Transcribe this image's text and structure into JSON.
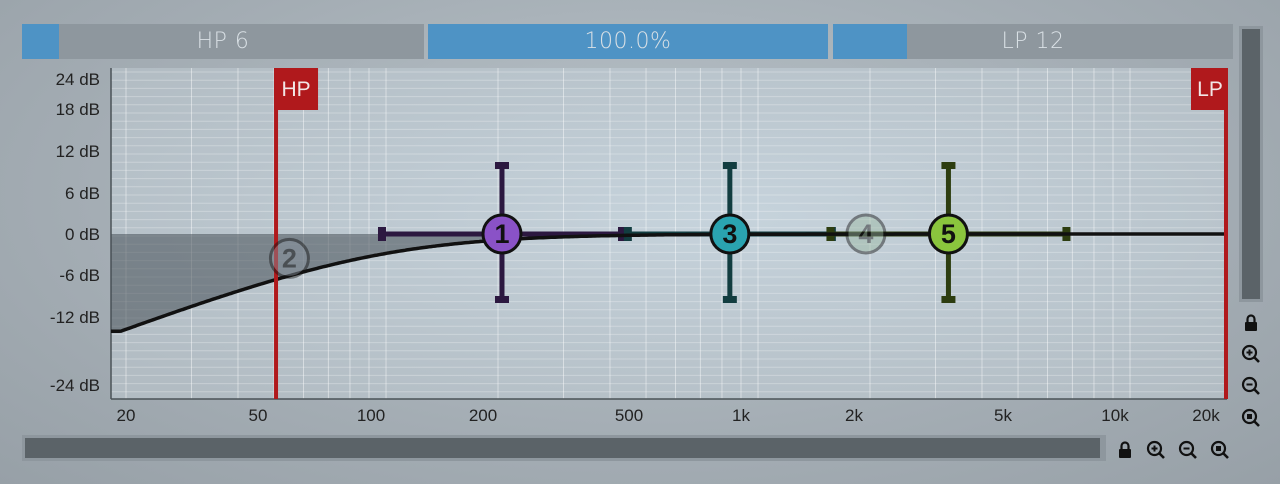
{
  "top_bar": {
    "hp_label": "HP 6",
    "hp_fill_fraction": 0.09,
    "mix_label": "100.0%",
    "mix_fill_fraction": 1.0,
    "lp_label": "LP 12",
    "lp_fill_fraction": 0.19
  },
  "y_axis": {
    "labels": [
      "24 dB",
      "18 dB",
      "12 dB",
      "6 dB",
      "0 dB",
      "-6 dB",
      "-12 dB",
      "-24 dB"
    ]
  },
  "x_axis": {
    "labels": [
      "20",
      "50",
      "100",
      "200",
      "500",
      "1k",
      "2k",
      "5k",
      "10k",
      "20k"
    ]
  },
  "filters": {
    "hp_label": "HP",
    "hp_frequency_hz": 50,
    "lp_label": "LP",
    "lp_frequency_hz": 20000
  },
  "bands": [
    {
      "label": "1",
      "freq_hz": 205,
      "gain_db": 0,
      "color": "#8a52c7",
      "line": "#2c1840",
      "active": true
    },
    {
      "label": "2",
      "freq_hz": 55,
      "gain_db": -3.5,
      "color": "#8a94a0",
      "line": "#6a7480",
      "active": false
    },
    {
      "label": "3",
      "freq_hz": 840,
      "gain_db": 0,
      "color": "#2aa3b0",
      "line": "#123d40",
      "active": true
    },
    {
      "label": "4",
      "freq_hz": 1950,
      "gain_db": 0,
      "color": "#9ab8a0",
      "line": "#4a6a50",
      "active": false
    },
    {
      "label": "5",
      "freq_hz": 3250,
      "gain_db": 0,
      "color": "#8ac53d",
      "line": "#2d3d10",
      "active": true
    }
  ],
  "colors": {
    "filter_red": "#b0191c",
    "curve": "#111111",
    "accent_blue": "#4e93c5"
  },
  "tools": {
    "vertical": [
      "lock-icon",
      "zoom-in-icon",
      "zoom-out-icon",
      "zoom-reset-icon"
    ],
    "horizontal": [
      "lock-icon",
      "zoom-in-icon",
      "zoom-out-icon",
      "zoom-reset-icon"
    ]
  }
}
